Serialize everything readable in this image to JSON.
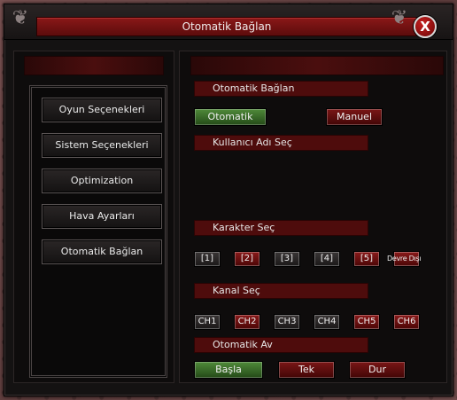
{
  "window": {
    "title": "Otomatik Bağlan",
    "close_label": "X"
  },
  "menu": {
    "items": [
      {
        "label": "Oyun Seçenekleri"
      },
      {
        "label": "Sistem Seçenekleri"
      },
      {
        "label": "Optimization"
      },
      {
        "label": "Hava Ayarları"
      },
      {
        "label": "Otomatik Bağlan"
      }
    ]
  },
  "auto_connect": {
    "header": "Otomatik Bağlan",
    "auto_button": "Otomatik",
    "manual_button": "Manuel"
  },
  "username": {
    "header": "Kullanıcı Adı Seç"
  },
  "character": {
    "header": "Karakter Seç",
    "slots": [
      "[1]",
      "[2]",
      "[3]",
      "[4]",
      "[5]",
      "Devre Dışı"
    ]
  },
  "channel": {
    "header": "Kanal Seç",
    "channels": [
      "CH1",
      "CH2",
      "CH3",
      "CH4",
      "CH5",
      "CH6"
    ]
  },
  "auto_hunt": {
    "header": "Otomatik Av",
    "start_button": "Başla",
    "single_button": "Tek",
    "stop_button": "Dur"
  },
  "colors": {
    "accent_red": "#7a1616",
    "accent_green": "#4f8a3a",
    "panel_bg": "#0e0c0c",
    "section_bar": "#4e0c0c"
  }
}
